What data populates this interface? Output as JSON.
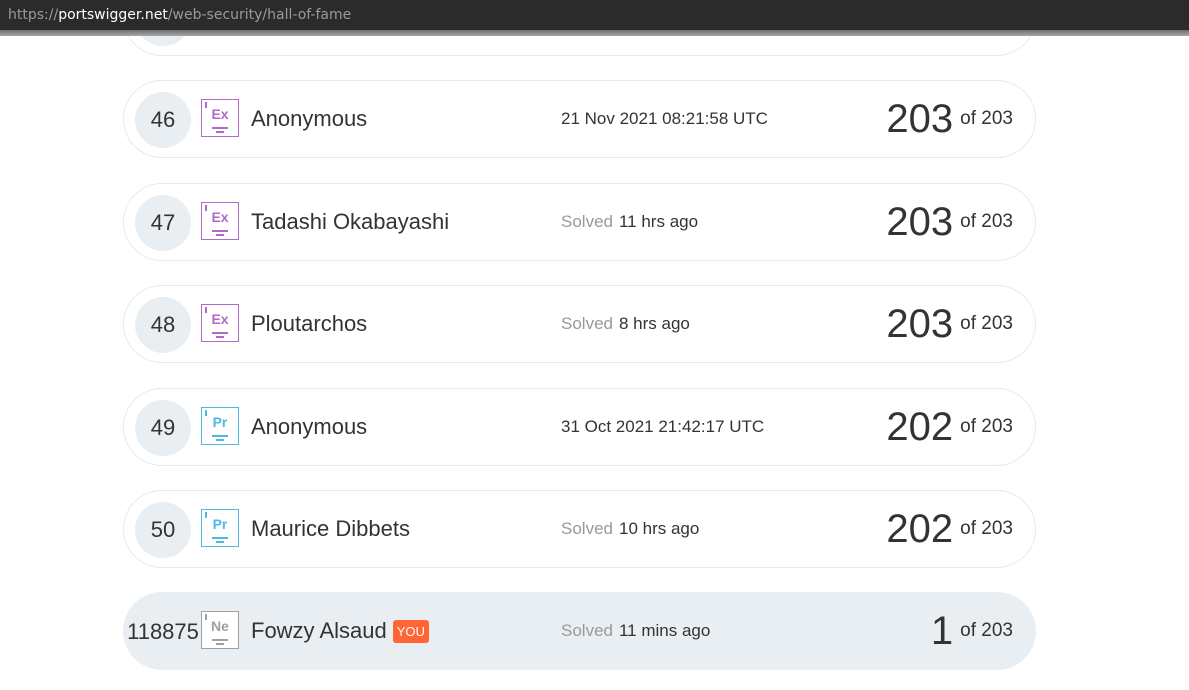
{
  "browser": {
    "url_prefix": "https://",
    "url_host": "portswigger.net",
    "url_path": "/web-security/hall-of-fame"
  },
  "leaderboard": {
    "rows": [
      {
        "rank": "46",
        "badge": "Ex",
        "badge_type": "ex",
        "name": "Anonymous",
        "solved_label": "",
        "time": "21 Nov 2021 08:21:58 UTC",
        "score": "203",
        "total": "of 203"
      },
      {
        "rank": "47",
        "badge": "Ex",
        "badge_type": "ex",
        "name": "Tadashi Okabayashi",
        "solved_label": "Solved",
        "time": "11 hrs ago",
        "score": "203",
        "total": "of 203"
      },
      {
        "rank": "48",
        "badge": "Ex",
        "badge_type": "ex",
        "name": "Ploutarchos",
        "solved_label": "Solved",
        "time": "8 hrs ago",
        "score": "203",
        "total": "of 203"
      },
      {
        "rank": "49",
        "badge": "Pr",
        "badge_type": "pr",
        "name": "Anonymous",
        "solved_label": "",
        "time": "31 Oct 2021 21:42:17 UTC",
        "score": "202",
        "total": "of 203"
      },
      {
        "rank": "50",
        "badge": "Pr",
        "badge_type": "pr",
        "name": "Maurice Dibbets",
        "solved_label": "Solved",
        "time": "10 hrs ago",
        "score": "202",
        "total": "of 203"
      }
    ],
    "current_user": {
      "rank": "118875",
      "badge": "Ne",
      "badge_type": "ne",
      "name": "Fowzy Alsaud",
      "you_tag": "YOU",
      "solved_label": "Solved",
      "time": "11 mins ago",
      "score": "1",
      "total": "of 203"
    }
  },
  "colors": {
    "expert": "#b26ac8",
    "practitioner": "#4fb8e3",
    "newcomer": "#a0a0a0",
    "you_tag": "#ff6633"
  }
}
